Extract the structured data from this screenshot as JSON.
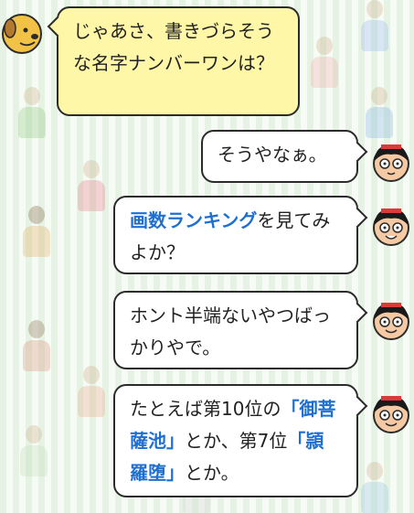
{
  "chat": {
    "messages": [
      {
        "speaker": "dog",
        "text": "じゃあさ、書きづらそうな名字ナンバーワンは？"
      },
      {
        "speaker": "boy",
        "text": "そうやなぁ。"
      },
      {
        "speaker": "boy",
        "parts": [
          "画数ランキング",
          "を見てみよか？"
        ]
      },
      {
        "speaker": "boy",
        "text": "ホント半端ないやつばっかりやで。"
      },
      {
        "speaker": "boy",
        "parts": [
          "たとえば第10位の",
          "「御菩薩池」",
          "とか、第7位",
          "「頴羅堕」",
          "とか。"
        ]
      }
    ]
  },
  "colors": {
    "left_bubble": "#fff7a8",
    "right_bubble": "#ffffff",
    "highlight": "#1f6fd1",
    "stripe": "#e6f3e4"
  },
  "icons": {
    "dog_avatar": "dog-avatar-icon",
    "boy_avatar": "boy-avatar-icon"
  }
}
